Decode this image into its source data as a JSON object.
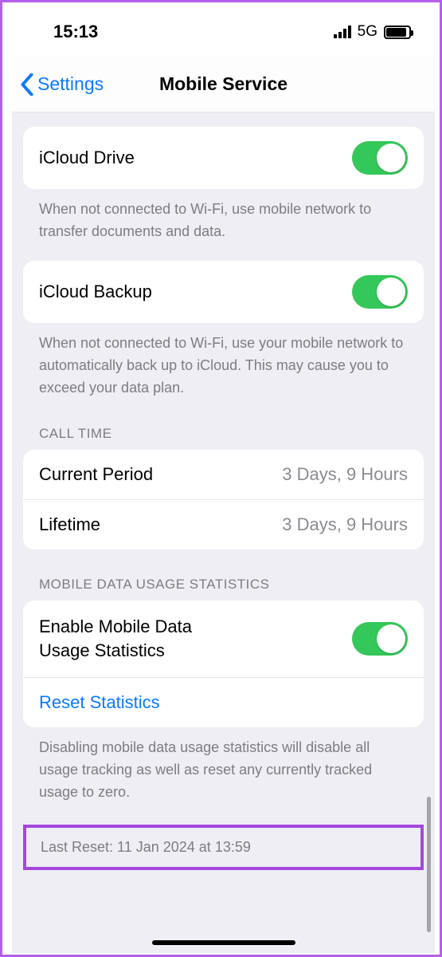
{
  "status": {
    "time": "15:13",
    "network": "5G"
  },
  "nav": {
    "back_label": "Settings",
    "title": "Mobile Service"
  },
  "icloud_drive": {
    "label": "iCloud Drive",
    "enabled": true,
    "footer": "When not connected to Wi-Fi, use mobile network to transfer documents and data."
  },
  "icloud_backup": {
    "label": "iCloud Backup",
    "enabled": true,
    "footer": "When not connected to Wi-Fi, use your mobile network to automatically back up to iCloud. This may cause you to exceed your data plan."
  },
  "call_time": {
    "header": "Call Time",
    "current_period_label": "Current Period",
    "current_period_value": "3 Days, 9 Hours",
    "lifetime_label": "Lifetime",
    "lifetime_value": "3 Days, 9 Hours"
  },
  "usage_stats": {
    "header": "Mobile Data Usage Statistics",
    "enable_label": "Enable Mobile Data Usage Statistics",
    "enabled": true,
    "reset_label": "Reset Statistics",
    "footer": "Disabling mobile data usage statistics will disable all usage tracking as well as reset any currently tracked usage to zero.",
    "last_reset": "Last Reset: 11 Jan 2024 at 13:59"
  }
}
